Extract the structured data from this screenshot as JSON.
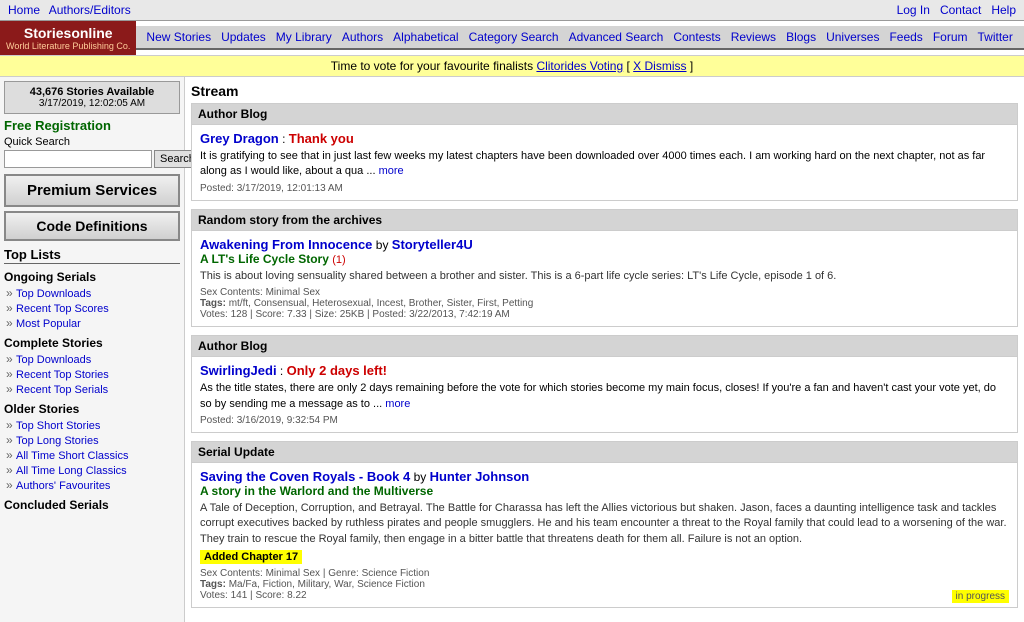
{
  "topnav": {
    "left_links": [
      {
        "label": "Home",
        "href": "#"
      },
      {
        "label": "Authors/Editors",
        "href": "#"
      }
    ],
    "right_links": [
      {
        "label": "Log In",
        "href": "#"
      },
      {
        "label": "Contact",
        "href": "#"
      },
      {
        "label": "Help",
        "href": "#"
      }
    ]
  },
  "logo": {
    "site_name": "Storiesonline",
    "tagline": "World Literature Publishing Co."
  },
  "mainnav": {
    "links": [
      {
        "label": "New Stories"
      },
      {
        "label": "Updates"
      },
      {
        "label": "My Library"
      },
      {
        "label": "Authors"
      },
      {
        "label": "Alphabetical"
      },
      {
        "label": "Category Search"
      },
      {
        "label": "Advanced Search"
      },
      {
        "label": "Contests"
      },
      {
        "label": "Reviews"
      },
      {
        "label": "Blogs"
      },
      {
        "label": "Universes"
      },
      {
        "label": "Feeds"
      },
      {
        "label": "Forum"
      },
      {
        "label": "Twitter"
      }
    ]
  },
  "banner": {
    "text": "Time to vote for your favourite finalists",
    "link_text": "Clitorides Voting",
    "dismiss_text": "X Dismiss"
  },
  "sidebar": {
    "stats_count": "43,676 Stories Available",
    "stats_date": "3/17/2019, 12:02:05 AM",
    "free_registration": "Free Registration",
    "quick_search_label": "Quick Search",
    "search_placeholder": "",
    "search_button": "Search",
    "premium_label": "Premium Services",
    "code_def_label": "Code Definitions",
    "top_lists_label": "Top Lists",
    "ongoing_serials_label": "Ongoing Serials",
    "ongoing_links": [
      {
        "label": "Top Downloads"
      },
      {
        "label": "Recent Top Scores"
      },
      {
        "label": "Most Popular"
      }
    ],
    "complete_stories_label": "Complete Stories",
    "complete_links": [
      {
        "label": "Top Downloads"
      },
      {
        "label": "Recent Top Stories"
      },
      {
        "label": "Recent Top Serials"
      }
    ],
    "older_stories_label": "Older Stories",
    "older_links": [
      {
        "label": "Top Short Stories"
      },
      {
        "label": "Top Long Stories"
      },
      {
        "label": "All Time Short Classics"
      },
      {
        "label": "All Time Long Classics"
      },
      {
        "label": "Authors' Favourites"
      }
    ],
    "concluded_label": "Concluded Serials"
  },
  "main": {
    "stream_title": "Stream",
    "sections": [
      {
        "id": "author_blog_1",
        "header": "Author Blog",
        "author": "Grey Dragon",
        "blog_title": "Thank you",
        "blog_text": "It is gratifying to see that in just last few weeks my latest chapters have been downloaded over 4000 times each. I am working hard on the next chapter, not as far along as I would like, about a qua",
        "more": "more",
        "posted": "Posted: 3/17/2019, 12:01:13 AM"
      },
      {
        "id": "random_story",
        "header": "Random story from the archives",
        "story_title": "Awakening From Innocence",
        "story_by": "by",
        "story_author": "Storyteller4U",
        "story_sub_title": "A LT's Life Cycle Story",
        "story_number": "(1)",
        "story_desc": "This is about loving sensuality shared between a brother and sister. This is a 6-part life cycle series: LT's Life Cycle, episode 1 of 6.",
        "sex_contents": "Sex Contents: Minimal Sex",
        "tags_label": "Tags:",
        "tags": "mt/ft, Consensual, Heterosexual, Incest, Brother, Sister, First, Petting",
        "votes": "Votes: 128",
        "score": "Score: 7.33",
        "size": "Size: 25KB",
        "posted": "Posted: 3/22/2013, 7:42:19 AM"
      },
      {
        "id": "author_blog_2",
        "header": "Author Blog",
        "author": "SwirlingJedi",
        "blog_title": "Only 2 days left!",
        "blog_text": "As the title states, there are only 2 days remaining before the vote for which stories become my main focus, closes! If you're a fan and haven't cast your vote yet, do so by sending me a message as to",
        "more": "more",
        "posted": "Posted: 3/16/2019, 9:32:54 PM"
      },
      {
        "id": "serial_update",
        "header": "Serial Update",
        "story_title": "Saving the Coven Royals - Book 4",
        "story_by": "by",
        "story_author": "Hunter Johnson",
        "story_sub_title": "A story in the Warlord and the Multiverse",
        "story_desc": "A Tale of Deception, Corruption, and Betrayal. The Battle for Charassa has left the Allies victorious but shaken. Jason, faces a daunting intelligence task and tackles corrupt executives backed by ruthless pirates and people smugglers. He and his team encounter a threat to the Royal family that could lead to a worsening of the war. They train to rescue the Royal family, then engage in a bitter battle that threatens death for them all. Failure is not an option.",
        "added_chapter": "Added Chapter 17",
        "sex_contents": "Sex Contents: Minimal Sex",
        "genre_label": "Genre:",
        "genre": "Science Fiction",
        "tags_label": "Tags:",
        "tags": "Ma/Fa, Fiction, Military, War, Science Fiction",
        "votes": "Votes: 141",
        "score": "Score: 8.22",
        "in_progress": "in progress"
      }
    ]
  }
}
